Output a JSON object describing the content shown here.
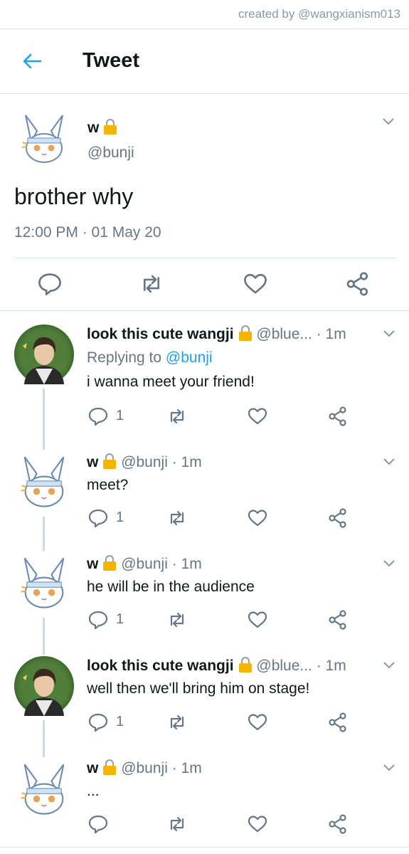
{
  "credit": "created by @wangxianism013",
  "header": {
    "title": "Tweet"
  },
  "main_tweet": {
    "name": "w",
    "handle": "@bunji",
    "text": "brother why",
    "time": "12:00 PM · 01 May 20"
  },
  "replies": [
    {
      "name": "look this cute wangji",
      "meta": "@blue... · 1m",
      "replying_label": "Replying to ",
      "replying_handle": "@bunji",
      "text": "i wanna meet your friend!",
      "reply_count": "1",
      "avatar": "person-avatar"
    },
    {
      "name": "w",
      "meta": "@bunji · 1m",
      "text": "meet?",
      "reply_count": "1",
      "avatar": "bunny-avatar"
    },
    {
      "name": "w",
      "meta": "@bunji · 1m",
      "text": "he will be in the audience",
      "reply_count": "1",
      "avatar": "bunny-avatar"
    },
    {
      "name": "look this cute wangji",
      "meta": "@blue... · 1m",
      "text": "well then we'll bring him on stage!",
      "reply_count": "1",
      "avatar": "person-avatar"
    },
    {
      "name": "w",
      "meta": "@bunji · 1m",
      "text": "...",
      "reply_count": "",
      "avatar": "bunny-avatar"
    }
  ],
  "icons": [
    "back-arrow-icon",
    "chevron-down-icon",
    "reply-icon",
    "retweet-icon",
    "like-icon",
    "share-icon",
    "lock-icon"
  ],
  "colors": {
    "accent": "#1da1f2",
    "secondary_text": "#657786",
    "divider": "#d8e2ea",
    "lock": "#f5b400"
  }
}
